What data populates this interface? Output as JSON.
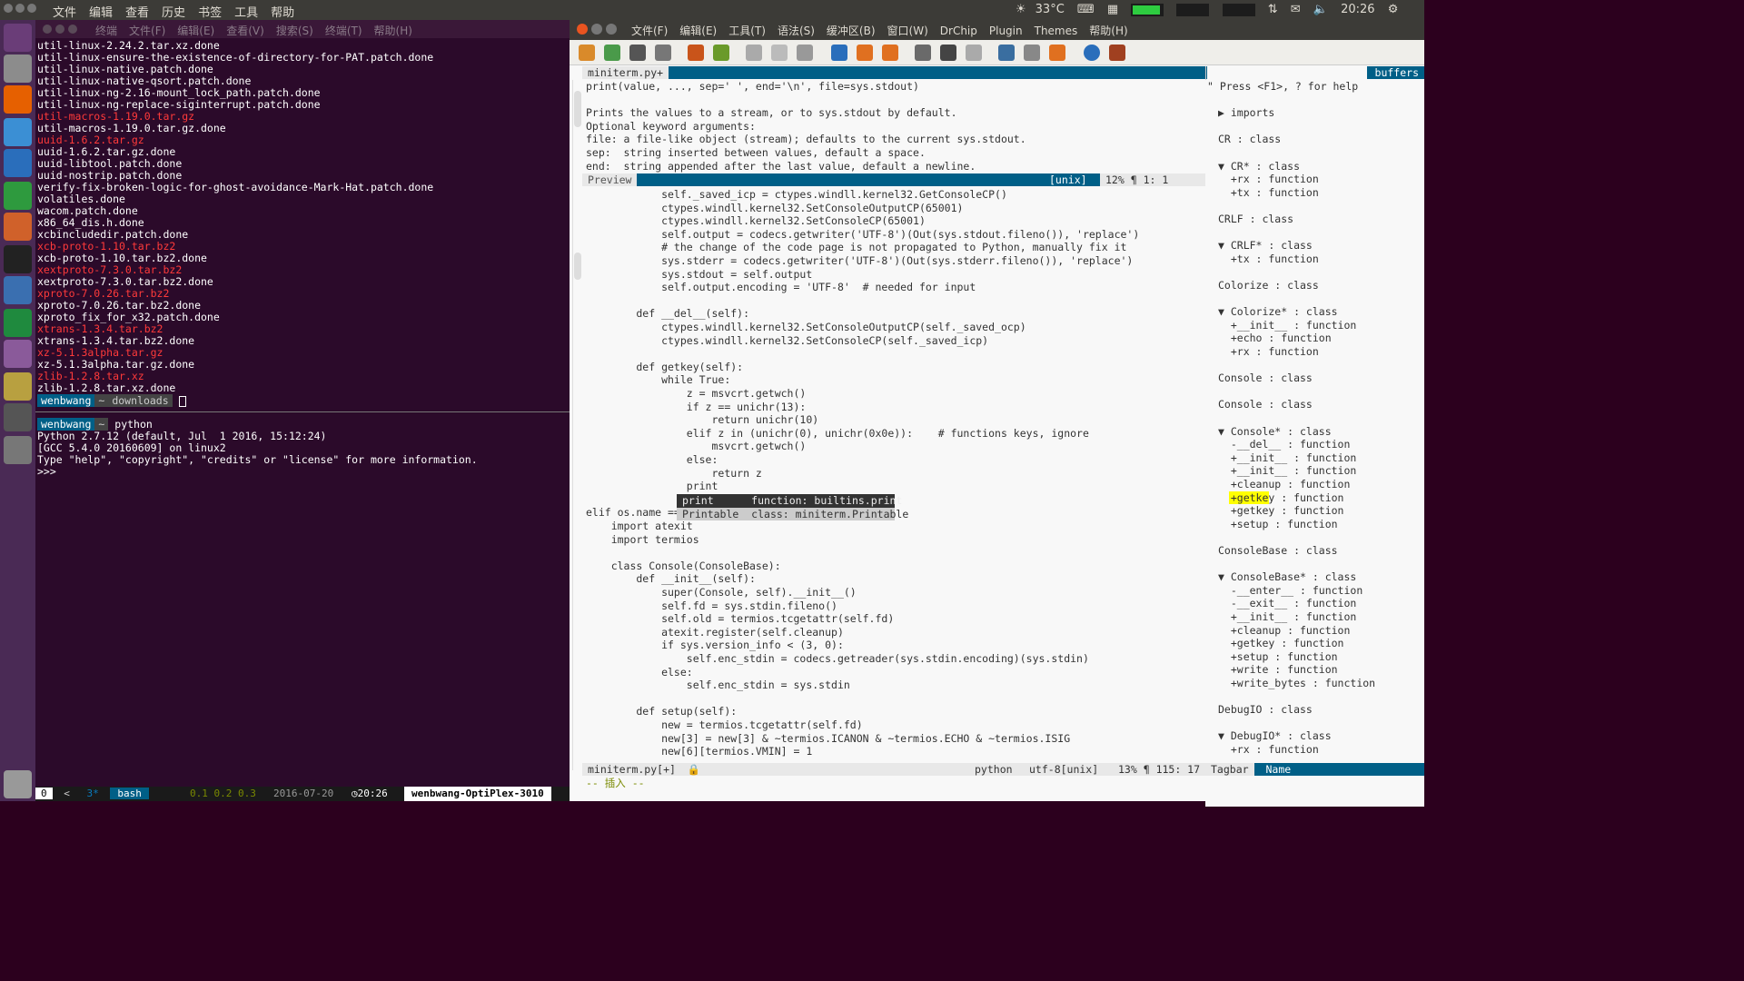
{
  "topbar": {
    "menus": [
      "文件",
      "编辑",
      "查看",
      "历史",
      "书签",
      "工具",
      "帮助"
    ],
    "temp": "33°C",
    "time": "20:26"
  },
  "terminal": {
    "title_menus": [
      "终端",
      "文件(F)",
      "编辑(E)",
      "查看(V)",
      "搜索(S)",
      "终端(T)",
      "帮助(H)"
    ],
    "lines": [
      {
        "t": "util-linux-2.24.2.tar.xz.done",
        "c": "w"
      },
      {
        "t": "util-linux-ensure-the-existence-of-directory-for-PAT.patch.done",
        "c": "w"
      },
      {
        "t": "util-linux-native.patch.done",
        "c": "w"
      },
      {
        "t": "util-linux-native-qsort.patch.done",
        "c": "w"
      },
      {
        "t": "util-linux-ng-2.16-mount_lock_path.patch.done",
        "c": "w"
      },
      {
        "t": "util-linux-ng-replace-siginterrupt.patch.done",
        "c": "w"
      },
      {
        "t": "util-macros-1.19.0.tar.gz",
        "c": "r"
      },
      {
        "t": "util-macros-1.19.0.tar.gz.done",
        "c": "w"
      },
      {
        "t": "uuid-1.6.2.tar.gz",
        "c": "r"
      },
      {
        "t": "uuid-1.6.2.tar.gz.done",
        "c": "w"
      },
      {
        "t": "uuid-libtool.patch.done",
        "c": "w"
      },
      {
        "t": "uuid-nostrip.patch.done",
        "c": "w"
      },
      {
        "t": "verify-fix-broken-logic-for-ghost-avoidance-Mark-Hat.patch.done",
        "c": "w"
      },
      {
        "t": "volatiles.done",
        "c": "w"
      },
      {
        "t": "wacom.patch.done",
        "c": "w"
      },
      {
        "t": "x86_64_dis.h.done",
        "c": "w"
      },
      {
        "t": "xcbincludedir.patch.done",
        "c": "w"
      },
      {
        "t": "xcb-proto-1.10.tar.bz2",
        "c": "r"
      },
      {
        "t": "xcb-proto-1.10.tar.bz2.done",
        "c": "w"
      },
      {
        "t": "xextproto-7.3.0.tar.bz2",
        "c": "r"
      },
      {
        "t": "xextproto-7.3.0.tar.bz2.done",
        "c": "w"
      },
      {
        "t": "xproto-7.0.26.tar.bz2",
        "c": "r"
      },
      {
        "t": "xproto-7.0.26.tar.bz2.done",
        "c": "w"
      },
      {
        "t": "xproto_fix_for_x32.patch.done",
        "c": "w"
      },
      {
        "t": "xtrans-1.3.4.tar.bz2",
        "c": "r"
      },
      {
        "t": "xtrans-1.3.4.tar.bz2.done",
        "c": "w"
      },
      {
        "t": "xz-5.1.3alpha.tar.gz",
        "c": "r"
      },
      {
        "t": "xz-5.1.3alpha.tar.gz.done",
        "c": "w"
      },
      {
        "t": "zlib-1.2.8.tar.xz",
        "c": "r"
      },
      {
        "t": "zlib-1.2.8.tar.xz.done",
        "c": "w"
      }
    ],
    "prompt1": {
      "user": "wenbwang",
      "sep": "~",
      "dir": "downloads"
    },
    "prompt2": {
      "user": "wenbwang",
      "sep": "~",
      "cmd": "python"
    },
    "py": [
      "Python 2.7.12 (default, Jul  1 2016, 15:12:24)",
      "[GCC 5.4.0 20160609] on linux2",
      "Type \"help\", \"copyright\", \"credits\" or \"license\" for more information.",
      ">>> "
    ],
    "tmux": {
      "win": "0",
      "arrow": "<",
      "tab": "3*",
      "name": "bash",
      "load": "0.1 0.2 0.3",
      "date": "2016-07-20",
      "clock": "20:26",
      "host": "wenbwang-OptiPlex-3010"
    }
  },
  "gvim": {
    "menus": [
      "文件(F)",
      "编辑(E)",
      "工具(T)",
      "语法(S)",
      "缓冲区(B)",
      "窗口(W)",
      "DrChip",
      "Plugin",
      "Themes",
      "帮助(H)"
    ],
    "tab": "miniterm.py+",
    "buffers": "buffers",
    "preview": [
      "print(value, ..., sep=' ', end='\\n', file=sys.stdout)",
      "",
      "Prints the values to a stream, or to sys.stdout by default.",
      "Optional keyword arguments:",
      "file: a file-like object (stream); defaults to the current sys.stdout.",
      "sep:  string inserted between values, default a space.",
      "end:  string appended after the last value, default a newline."
    ],
    "preview_status": {
      "name": "Preview",
      "ff": "[unix]",
      "pct": "12%",
      "pos": "1:  1"
    },
    "popup": [
      {
        "w": "print",
        "k": "function: builtins.print"
      },
      {
        "w": "Printable",
        "k": "class: miniterm.Printable"
      }
    ],
    "status": {
      "file": "miniterm.py[+]",
      "ft": "python",
      "enc": "utf-8[unix]",
      "pct": "13%",
      "pos": "115: 17"
    },
    "mode": "-- 插入 --",
    "tagbar_title": "Tagbar",
    "tagbar_name": "Name",
    "help": "\" Press <F1>, ? for help"
  },
  "tagbar": [
    {
      "t": "▶ imports",
      "k": "h"
    },
    {
      "t": "",
      "k": "b"
    },
    {
      "t": "CR : class",
      "k": "c"
    },
    {
      "t": "",
      "k": "b"
    },
    {
      "t": "▼ CR* : class",
      "k": "c"
    },
    {
      "t": "  +rx : function",
      "k": "f"
    },
    {
      "t": "  +tx : function",
      "k": "f"
    },
    {
      "t": "",
      "k": "b"
    },
    {
      "t": "CRLF : class",
      "k": "c"
    },
    {
      "t": "",
      "k": "b"
    },
    {
      "t": "▼ CRLF* : class",
      "k": "c"
    },
    {
      "t": "  +tx : function",
      "k": "f"
    },
    {
      "t": "",
      "k": "b"
    },
    {
      "t": "Colorize : class",
      "k": "c"
    },
    {
      "t": "",
      "k": "b"
    },
    {
      "t": "▼ Colorize* : class",
      "k": "c"
    },
    {
      "t": "  +__init__ : function",
      "k": "f"
    },
    {
      "t": "  +echo : function",
      "k": "f"
    },
    {
      "t": "  +rx : function",
      "k": "f"
    },
    {
      "t": "",
      "k": "b"
    },
    {
      "t": "Console : class",
      "k": "c"
    },
    {
      "t": "",
      "k": "b"
    },
    {
      "t": "Console : class",
      "k": "c"
    },
    {
      "t": "",
      "k": "b"
    },
    {
      "t": "▼ Console* : class",
      "k": "c"
    },
    {
      "t": "  -__del__ : function",
      "k": "f"
    },
    {
      "t": "  +__init__ : function",
      "k": "f"
    },
    {
      "t": "  +__init__ : function",
      "k": "f"
    },
    {
      "t": "  +cleanup : function",
      "k": "f"
    },
    {
      "t": "  +getkey : function",
      "k": "hl"
    },
    {
      "t": "  +getkey : function",
      "k": "f"
    },
    {
      "t": "  +setup : function",
      "k": "f"
    },
    {
      "t": "",
      "k": "b"
    },
    {
      "t": "ConsoleBase : class",
      "k": "c"
    },
    {
      "t": "",
      "k": "b"
    },
    {
      "t": "▼ ConsoleBase* : class",
      "k": "c"
    },
    {
      "t": "  -__enter__ : function",
      "k": "f"
    },
    {
      "t": "  -__exit__ : function",
      "k": "f"
    },
    {
      "t": "  +__init__ : function",
      "k": "f"
    },
    {
      "t": "  +cleanup : function",
      "k": "f"
    },
    {
      "t": "  +getkey : function",
      "k": "f"
    },
    {
      "t": "  +setup : function",
      "k": "f"
    },
    {
      "t": "  +write : function",
      "k": "f"
    },
    {
      "t": "  +write_bytes : function",
      "k": "f"
    },
    {
      "t": "",
      "k": "b"
    },
    {
      "t": "DebugIO : class",
      "k": "c"
    },
    {
      "t": "",
      "k": "b"
    },
    {
      "t": "▼ DebugIO* : class",
      "k": "c"
    },
    {
      "t": "  +rx : function",
      "k": "f"
    }
  ],
  "code": [
    "            self._saved_icp = ctypes.windll.kernel32.GetConsoleCP()",
    "            ctypes.windll.kernel32.SetConsoleOutputCP(65001)",
    "            ctypes.windll.kernel32.SetConsoleCP(65001)",
    "            self.output = codecs.getwriter('UTF-8')(Out(sys.stdout.fileno()), 'replace')",
    "            # the change of the code page is not propagated to Python, manually fix it",
    "            sys.stderr = codecs.getwriter('UTF-8')(Out(sys.stderr.fileno()), 'replace')",
    "            sys.stdout = self.output",
    "            self.output.encoding = 'UTF-8'  # needed for input",
    "",
    "        def __del__(self):",
    "            ctypes.windll.kernel32.SetConsoleOutputCP(self._saved_ocp)",
    "            ctypes.windll.kernel32.SetConsoleCP(self._saved_icp)",
    "",
    "        def getkey(self):",
    "            while True:",
    "                z = msvcrt.getwch()",
    "                if z == unichr(13):",
    "                    return unichr(10)",
    "                elif z in (unichr(0), unichr(0x0e)):    # functions keys, ignore",
    "                    msvcrt.getwch()",
    "                else:",
    "                    return z",
    "                print",
    "",
    "elif os.name == 'posix':",
    "    import atexit",
    "    import termios",
    "",
    "    class Console(ConsoleBase):",
    "        def __init__(self):",
    "            super(Console, self).__init__()",
    "            self.fd = sys.stdin.fileno()",
    "            self.old = termios.tcgetattr(self.fd)",
    "            atexit.register(self.cleanup)",
    "            if sys.version_info < (3, 0):",
    "                self.enc_stdin = codecs.getreader(sys.stdin.encoding)(sys.stdin)",
    "            else:",
    "                self.enc_stdin = sys.stdin",
    "",
    "        def setup(self):",
    "            new = termios.tcgetattr(self.fd)",
    "            new[3] = new[3] & ~termios.ICANON & ~termios.ECHO & ~termios.ISIG",
    "            new[6][termios.VMIN] = 1"
  ]
}
